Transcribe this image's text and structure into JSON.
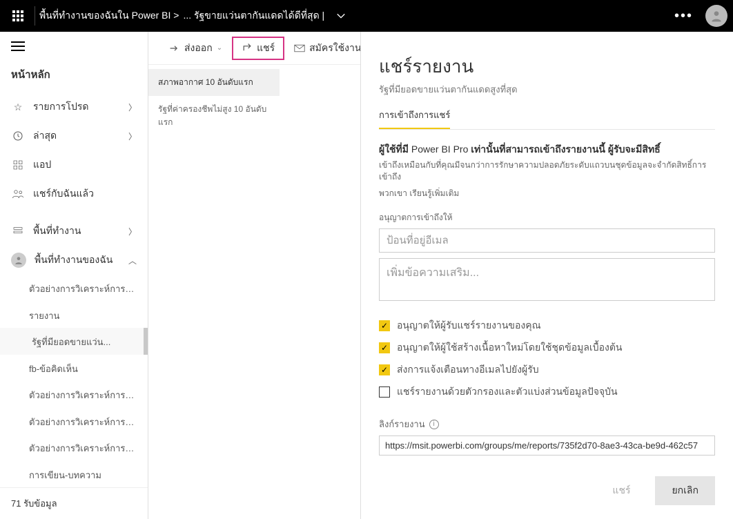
{
  "topbar": {
    "workspace_crumb": "พื้นที่ทำงานของฉันใน Power BI >",
    "report_crumb": "... รัฐขายแว่นตากันแดดได้ดีที่สุด |"
  },
  "leftnav": {
    "heading": "หน้าหลัก",
    "favorites": "รายการโปรด",
    "recent": "ล่าสุด",
    "apps": "แอป",
    "shared": "แชร์กับฉันแล้ว",
    "workspaces": "พื้นที่ทำงาน",
    "my_workspace": "พื้นที่ทำงานของฉัน",
    "subs": [
      "ตัวอย่างการวิเคราะห์การค้าปลีก...",
      "รายงาน",
      "รัฐที่มียอดขายแว่น...",
      "fb-ข้อคิดเห็น",
      "ตัวอย่างการวิเคราะห์การค้าปลีก...",
      "ตัวอย่างการวิเคราะห์การค้าปลีก...",
      "ตัวอย่างการวิเคราะห์การค้าปลีก...",
      "การเขียน-บทความ"
    ],
    "footer": "71 รับข้อมูล"
  },
  "toolbar": {
    "export": "ส่งออก",
    "share": "แชร์",
    "subscribe": "สมัครใช้งาน"
  },
  "pages": {
    "p1": "สภาพอากาศ 10 อันดับแรก",
    "p2": "รัฐที่ค่าครองชีพไม่สูง 10 อันดับแรก"
  },
  "share_panel": {
    "title": "แชร์รายงาน",
    "subtitle": "รัฐที่มียอดขายแว่นตากันแดดสูงที่สุด",
    "tab": "การเข้าถึงการแชร์",
    "notice_bold1": "ผู้ใช้ที่มี",
    "notice_pro": "Power BI Pro",
    "notice_bold2": "เท่านั้นที่สามารถเข้าถึงรายงานนี้ ผู้รับจะมีสิทธิ์",
    "notice_sub": "เข้าถึงเหมือนกับที่คุณมีจนกว่าการรักษาความปลอดภัยระดับแถวบนชุดข้อมูลจะจำกัดสิทธิ์การเข้าถึง",
    "learn_more_prefix": "พวกเขา",
    "learn_more": "เรียนรู้เพิ่มเติม",
    "grant_label": "อนุญาตการเข้าถึงให้",
    "email_placeholder": "ป้อนที่อยู่อีเมล",
    "message_placeholder": "เพิ่มข้อความเสริม...",
    "check1": "อนุญาตให้ผู้รับแชร์รายงานของคุณ",
    "check2": "อนุญาตให้ผู้ใช้สร้างเนื้อหาใหม่โดยใช้ชุดข้อมูลเบื้องต้น",
    "check3": "ส่งการแจ้งเตือนทางอีเมลไปยังผู้รับ",
    "check4": "แชร์รายงานด้วยตัวกรองและตัวแบ่งส่วนข้อมูลปัจจุบัน",
    "link_label": "ลิงก์รายงาน",
    "url": "https://msit.powerbi.com/groups/me/reports/735f2d70-8ae3-43ca-be9d-462c57",
    "btn_share": "แชร์",
    "btn_cancel": "ยกเลิก"
  }
}
